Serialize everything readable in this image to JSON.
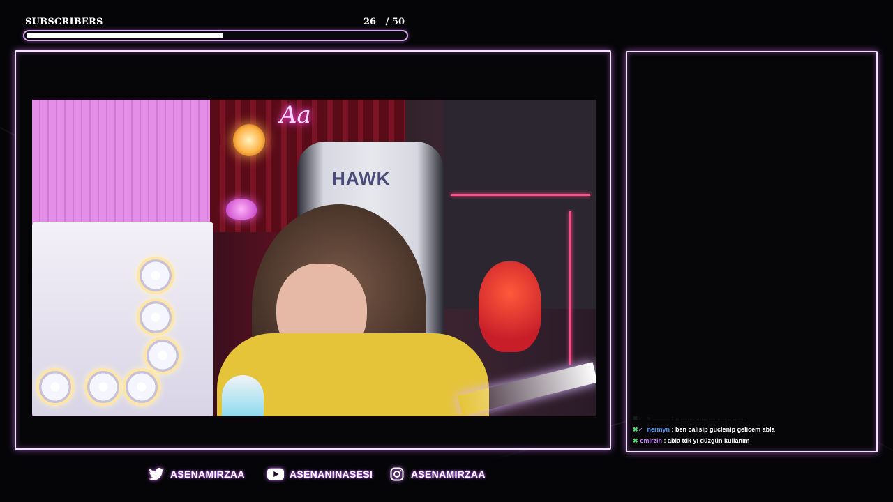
{
  "subscribers": {
    "label": "SUBSCRIBERS",
    "count_text": "26   / 50",
    "current": 26,
    "goal": 50,
    "progress_fraction": 0.52
  },
  "chat": {
    "messages": [
      {
        "user": "s...........",
        "text": ": ........... ...... .......... .. ........",
        "faded": true,
        "user_color": "#8a8a8a"
      },
      {
        "user": "nermyn",
        "text": ": ben calisip guclenip gelicem abla",
        "faded": false,
        "user_color": "#4f9bff"
      },
      {
        "user": "emirzin",
        "text": ": abla tdk yı düzgün kullanım",
        "faded": false,
        "user_color": "#c77dff"
      }
    ]
  },
  "socials": [
    {
      "platform": "twitter",
      "icon": "twitter-icon",
      "handle": "ASENAMIRZAA"
    },
    {
      "platform": "youtube",
      "icon": "youtube-icon",
      "handle": "ASENANINASESI"
    },
    {
      "platform": "instagram",
      "icon": "instagram-icon",
      "handle": "ASENAMIRZAA"
    }
  ],
  "webcam": {
    "neon_sign_text": "Aa",
    "chair_logo_text": "HAWK"
  },
  "colors": {
    "frame_glow": "#dc78ff",
    "progress_border": "#d9a8e8",
    "social_glow": "#c25cff",
    "chat_badge_green": "#47e06a"
  }
}
